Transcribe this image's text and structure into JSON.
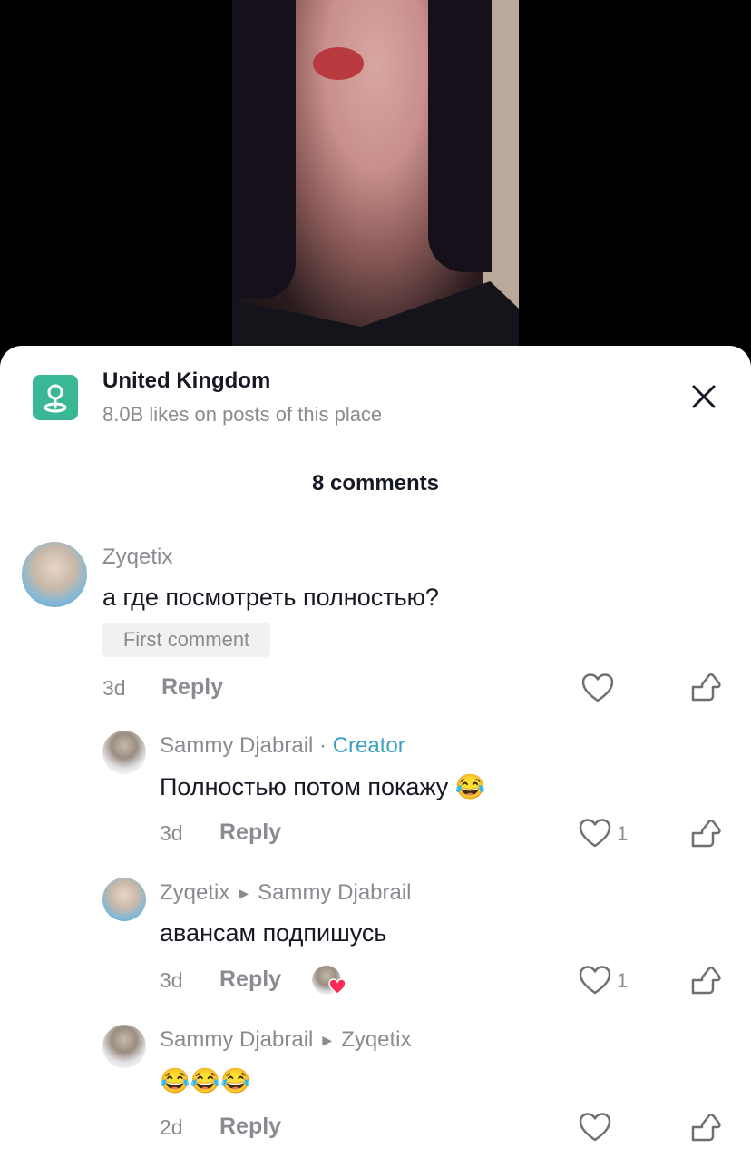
{
  "location": {
    "title": "United Kingdom",
    "subtitle": "8.0B likes on posts of this place",
    "icon": "location-pin-icon",
    "accent": "#3ab795"
  },
  "comments_count_label": "8 comments",
  "comments": [
    {
      "username": "Zyqetix",
      "text": "а где посмотреть полностью?",
      "badge": "First comment",
      "time": "3d",
      "reply_label": "Reply",
      "likes": ""
    },
    {
      "username": "Sammy Djabrail",
      "separator": "·",
      "role": "Creator",
      "text": "Полностью потом покажу 😂",
      "time": "3d",
      "reply_label": "Reply",
      "likes": "1"
    },
    {
      "username": "Zyqetix",
      "reply_to": "Sammy Djabrail",
      "text": "авансам подпишусь",
      "time": "3d",
      "reply_label": "Reply",
      "likes": "1",
      "creator_liked": true
    },
    {
      "username": "Sammy Djabrail",
      "reply_to": "Zyqetix",
      "text": "😂😂😂",
      "time": "2d",
      "reply_label": "Reply",
      "likes": ""
    }
  ],
  "colors": {
    "creator": "#3b9fc4",
    "muted": "#8a8b91",
    "text": "#161823"
  }
}
